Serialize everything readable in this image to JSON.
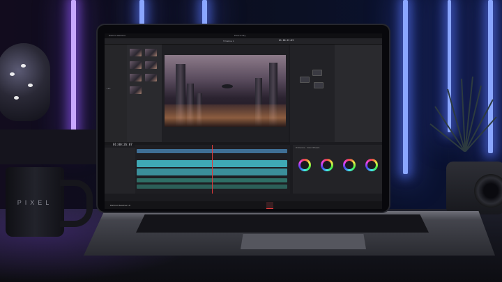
{
  "app": {
    "name": "DaVinci Resolve",
    "project_title": "Future City",
    "bottom_label": "DaVinci Resolve 19",
    "timecode": "01:00:26:07",
    "timeline_name": "Timeline 1",
    "viewer_timecode": "01:00:12:03",
    "color_node_label": "Primaries - Color Wheels"
  },
  "scene": {
    "mug_logo": "PIXEL"
  },
  "colors": {
    "accent": "#e03a3a",
    "video_track": "#3fa9b5",
    "audio_track": "#2f6f66",
    "light_strip": "#8aa6ff"
  }
}
